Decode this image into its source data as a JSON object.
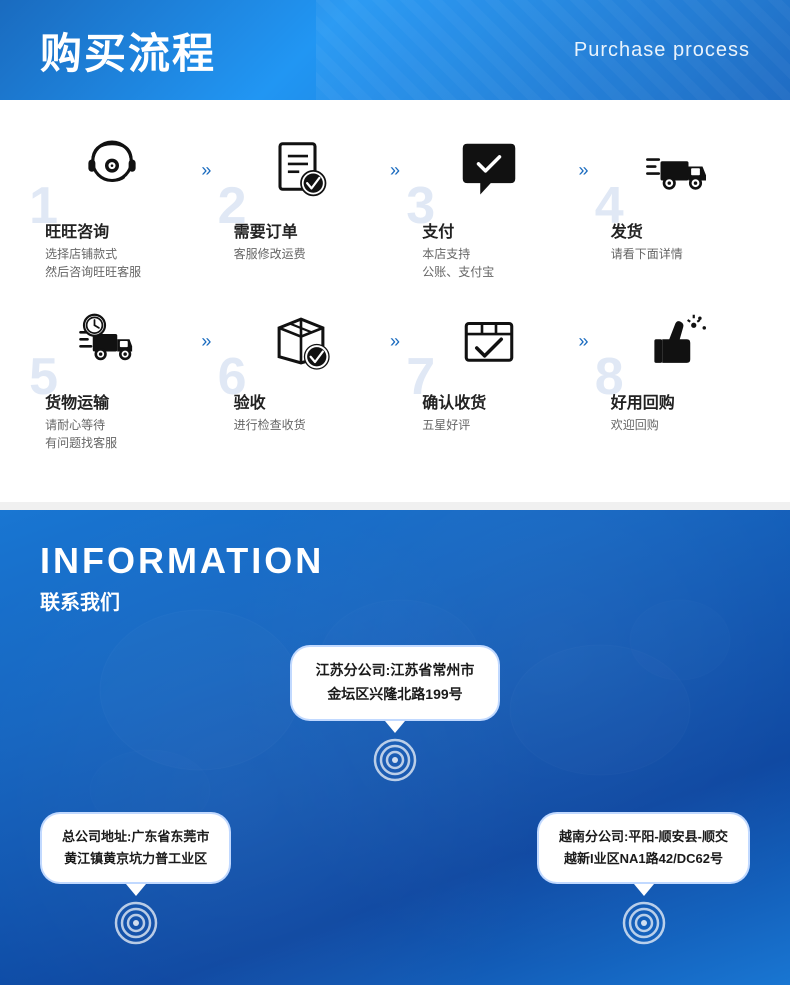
{
  "header": {
    "title_zh": "购买流程",
    "title_en": "Purchase process"
  },
  "process": {
    "row1": [
      {
        "step": "1",
        "title": "旺旺咨询",
        "desc": "选择店铺款式\n然后咨询旺旺客服",
        "icon": "headset"
      },
      {
        "step": "2",
        "title": "需要订单",
        "desc": "客服修改运费",
        "icon": "order"
      },
      {
        "step": "3",
        "title": "支付",
        "desc": "本店支持\n公账、支付宝",
        "icon": "payment"
      },
      {
        "step": "4",
        "title": "发货",
        "desc": "请看下面详情",
        "icon": "delivery"
      }
    ],
    "row2": [
      {
        "step": "5",
        "title": "货物运输",
        "desc": "请耐心等待\n有问题找客服",
        "icon": "transport"
      },
      {
        "step": "6",
        "title": "验收",
        "desc": "进行检查收货",
        "icon": "inspection"
      },
      {
        "step": "7",
        "title": "确认收货",
        "desc": "五星好评",
        "icon": "confirm"
      },
      {
        "step": "8",
        "title": "好用回购",
        "desc": "欢迎回购",
        "icon": "repurchase"
      }
    ],
    "arrow": "»"
  },
  "info": {
    "title_en": "INFORMATION",
    "title_zh": "联系我们",
    "bubbles": {
      "center": "江苏分公司:江苏省常州市\n金坛区兴隆北路199号",
      "left": "总公司地址:广东省东莞市\n黄江镇黄京坑力普工业区",
      "right": "越南分公司:平阳-顺安县-顺交\n越新I业区NA1路42/DC62号"
    }
  }
}
